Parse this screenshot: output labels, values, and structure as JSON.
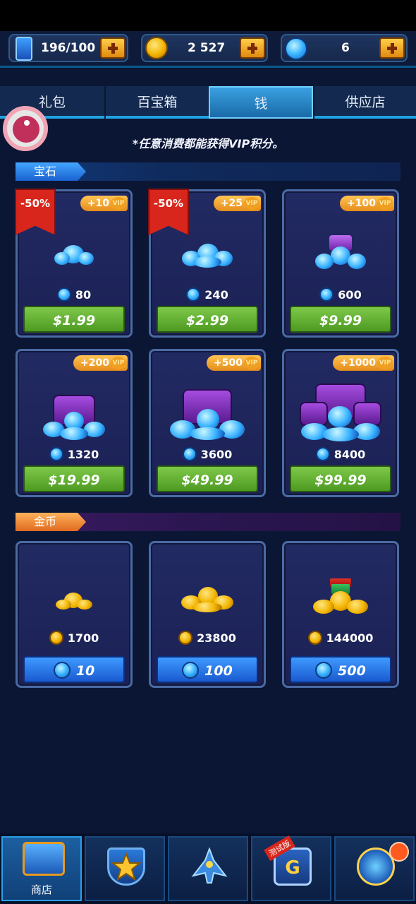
{
  "resources": {
    "energy": "196/100",
    "coins": "2 527",
    "gems": "6"
  },
  "tabs": [
    {
      "label": "礼包"
    },
    {
      "label": "百宝箱"
    },
    {
      "label": "钱",
      "active": true
    },
    {
      "label": "供应店"
    }
  ],
  "notice": "*任意消费都能获得VIP积分。",
  "gem_section": {
    "title": "宝石",
    "items": [
      {
        "discount": "-50%",
        "vip": "+10",
        "amount": "80",
        "price": "$1.99"
      },
      {
        "discount": "-50%",
        "vip": "+25",
        "amount": "240",
        "price": "$2.99"
      },
      {
        "discount": "",
        "vip": "+100",
        "amount": "600",
        "price": "$9.99"
      },
      {
        "discount": "",
        "vip": "+200",
        "amount": "1320",
        "price": "$19.99"
      },
      {
        "discount": "",
        "vip": "+500",
        "amount": "3600",
        "price": "$49.99"
      },
      {
        "discount": "",
        "vip": "+1000",
        "amount": "8400",
        "price": "$99.99"
      }
    ]
  },
  "coin_section": {
    "title": "金币",
    "items": [
      {
        "amount": "1700",
        "cost": "10"
      },
      {
        "amount": "23800",
        "cost": "100"
      },
      {
        "amount": "144000",
        "cost": "500"
      }
    ]
  },
  "bottom_nav": [
    {
      "label": "商店",
      "icon": "shop-cart-icon",
      "active": true
    },
    {
      "label": "",
      "icon": "star-badge-icon"
    },
    {
      "label": "",
      "icon": "spaceship-icon"
    },
    {
      "label": "",
      "icon": "g-shield-icon",
      "tag": "测试版"
    },
    {
      "label": "",
      "icon": "wheel-prize-icon",
      "badge": true
    }
  ],
  "colors": {
    "background": "#0b1634",
    "accent_blue": "#1fa3e0",
    "price_green": "#6ab83a",
    "discount_red": "#d8261c",
    "vip_orange": "#f2a23a"
  }
}
